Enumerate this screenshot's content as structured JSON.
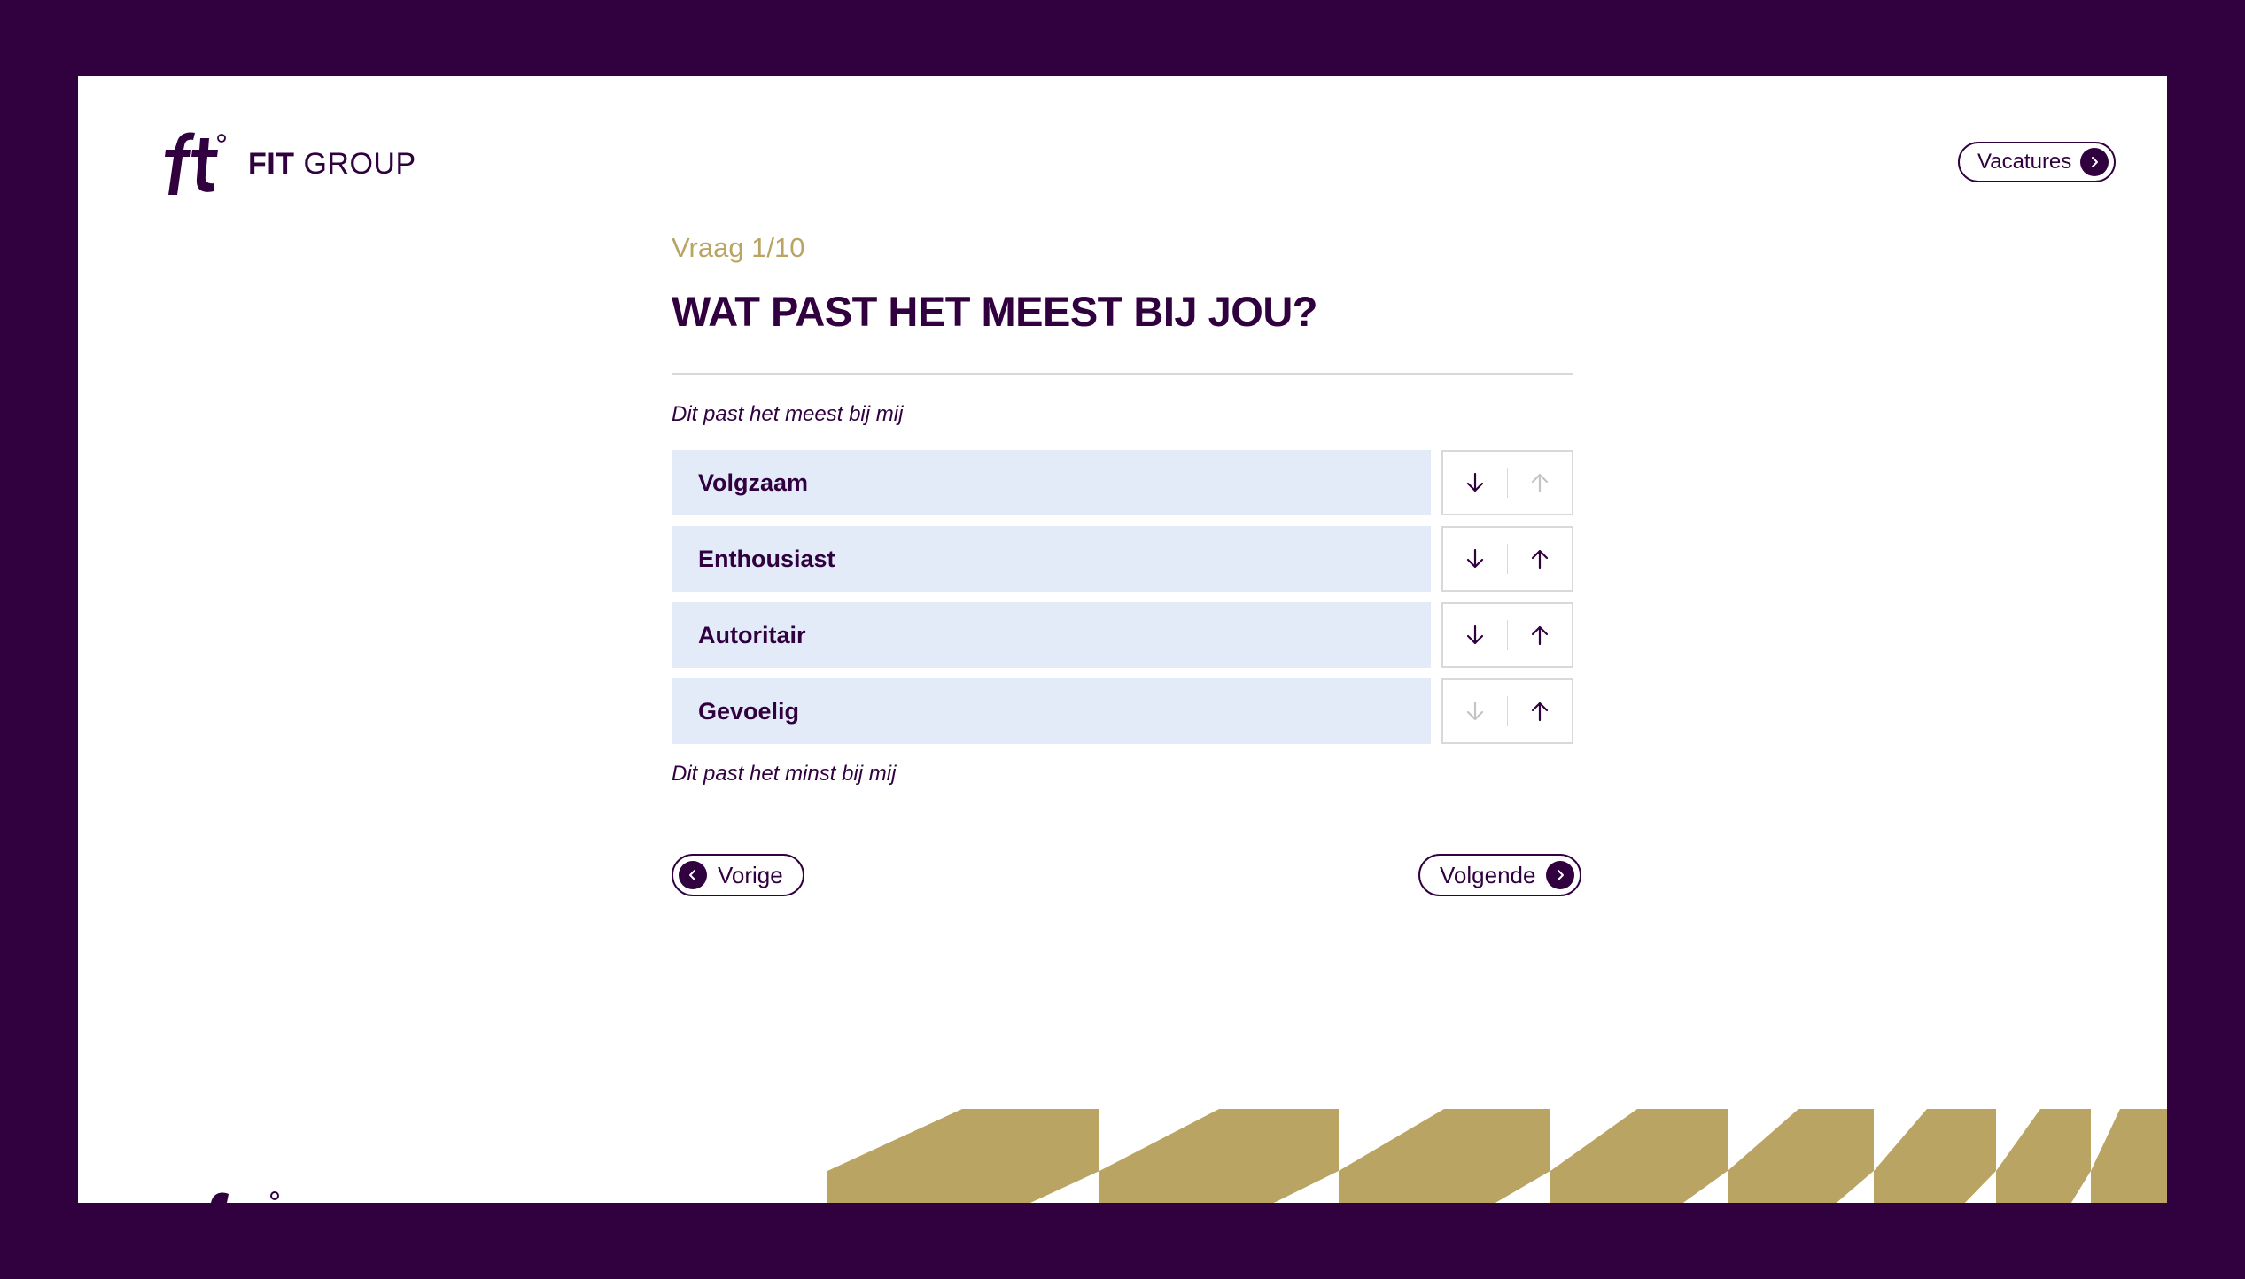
{
  "header": {
    "brand_bold": "FIT",
    "brand_light": "GROUP",
    "vacatures_label": "Vacatures"
  },
  "quiz": {
    "counter": "Vraag 1/10",
    "title": "WAT PAST HET MEEST BIJ JOU?",
    "hint_top": "Dit past het meest bij mij",
    "hint_bottom": "Dit past het minst bij mij",
    "options": [
      {
        "label": "Volgzaam",
        "down_enabled": true,
        "up_enabled": false
      },
      {
        "label": "Enthousiast",
        "down_enabled": true,
        "up_enabled": true
      },
      {
        "label": "Autoritair",
        "down_enabled": true,
        "up_enabled": true
      },
      {
        "label": "Gevoelig",
        "down_enabled": false,
        "up_enabled": true
      }
    ]
  },
  "nav": {
    "prev_label": "Vorige",
    "next_label": "Volgende"
  },
  "colors": {
    "brand_purple": "#31003f",
    "accent_gold": "#b9a463",
    "option_bg": "#e3ebf9",
    "disabled_arrow": "#c4c4c4"
  },
  "icons": {
    "logo": "ft-logo-icon",
    "chevron_right": "chevron-right-icon",
    "chevron_left": "chevron-left-icon",
    "arrow_down": "arrow-down-icon",
    "arrow_up": "arrow-up-icon"
  }
}
